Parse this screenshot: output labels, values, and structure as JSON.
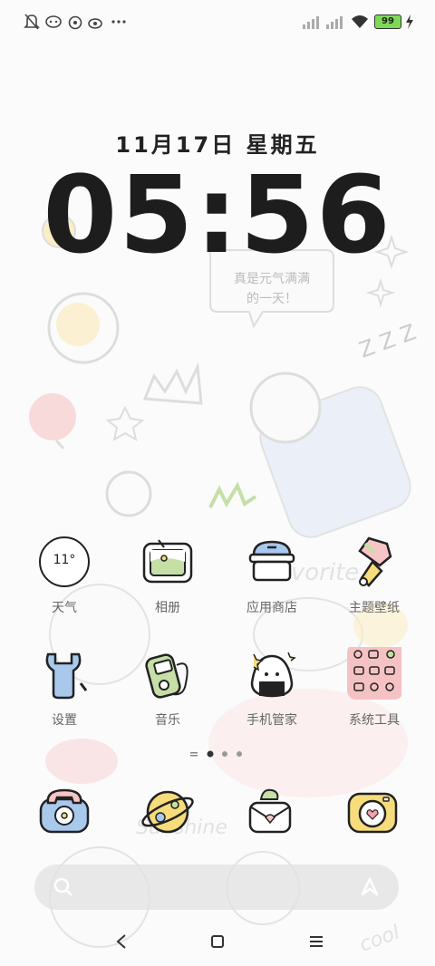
{
  "status_bar": {
    "battery_level": "99",
    "icons": [
      "mute-bell-icon",
      "messenger-icon",
      "alarm-icon",
      "weibo-icon",
      "more-dots-icon",
      "signal-icon",
      "signal-icon",
      "wifi-icon",
      "battery-icon",
      "charging-icon"
    ]
  },
  "clock": {
    "date": "11月17日  星期五",
    "time": "05:56"
  },
  "wallpaper": {
    "sticker_text_line1": "真是元气满满",
    "sticker_text_line2": "的一天！",
    "zzz": "Z Z Z",
    "favorite_text": "Favorite",
    "sunshine_text": "Sunshine",
    "cool_text": "cool"
  },
  "apps_row1": [
    {
      "label": "天气",
      "icon": "weather-icon",
      "temp": "11°"
    },
    {
      "label": "相册",
      "icon": "gallery-icon"
    },
    {
      "label": "应用商店",
      "icon": "app-store-icon"
    },
    {
      "label": "主题壁纸",
      "icon": "themes-icon"
    }
  ],
  "apps_row2": [
    {
      "label": "设置",
      "icon": "settings-icon"
    },
    {
      "label": "音乐",
      "icon": "music-icon"
    },
    {
      "label": "手机管家",
      "icon": "security-icon"
    },
    {
      "label": "系统工具",
      "icon": "tools-folder-icon"
    }
  ],
  "dock": [
    {
      "name": "phone-app",
      "icon": "phone-icon"
    },
    {
      "name": "browser-app",
      "icon": "planet-browser-icon"
    },
    {
      "name": "messages-app",
      "icon": "message-bird-icon"
    },
    {
      "name": "camera-app",
      "icon": "camera-icon"
    }
  ],
  "page_indicator": {
    "pages": 3,
    "current": 1
  },
  "colors": {
    "accent_blue": "#a8c8ec",
    "accent_pink": "#f7c5c5",
    "accent_yellow": "#f6dc7a",
    "accent_green": "#c5dfa6",
    "text_dark": "#1d1d1d",
    "label_gray": "#666666"
  }
}
